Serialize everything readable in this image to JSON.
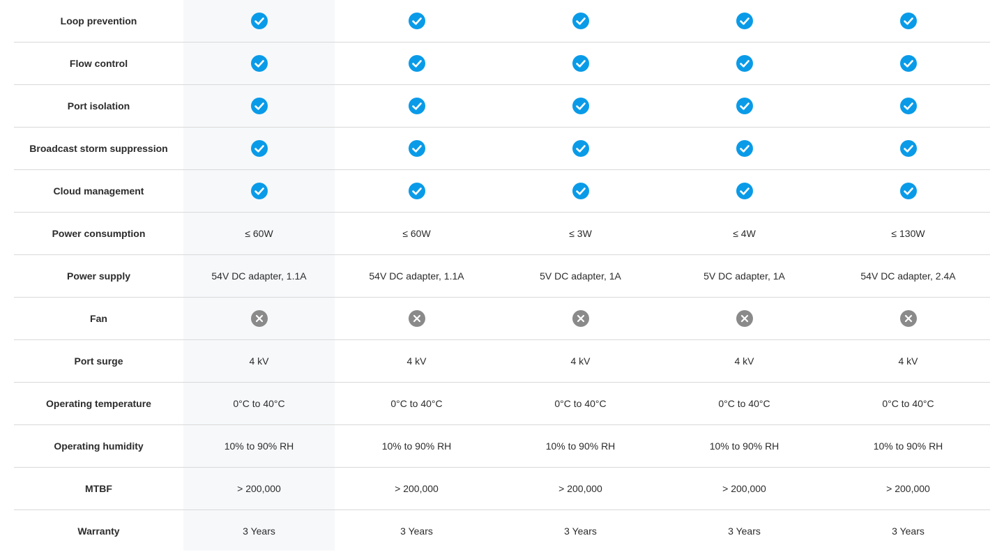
{
  "colors": {
    "check": "#0a9be8",
    "cross": "#8a8a8a",
    "highlight_column": "#f6f8fa",
    "divider": "#d9d9d9"
  },
  "rows": [
    {
      "label": "Loop prevention",
      "type": "icon",
      "cells": [
        "check-icon",
        "check-icon",
        "check-icon",
        "check-icon",
        "check-icon"
      ]
    },
    {
      "label": "Flow control",
      "type": "icon",
      "cells": [
        "check-icon",
        "check-icon",
        "check-icon",
        "check-icon",
        "check-icon"
      ]
    },
    {
      "label": "Port isolation",
      "type": "icon",
      "cells": [
        "check-icon",
        "check-icon",
        "check-icon",
        "check-icon",
        "check-icon"
      ]
    },
    {
      "label": "Broadcast storm suppression",
      "type": "icon",
      "cells": [
        "check-icon",
        "check-icon",
        "check-icon",
        "check-icon",
        "check-icon"
      ]
    },
    {
      "label": "Cloud management",
      "type": "icon",
      "cells": [
        "check-icon",
        "check-icon",
        "check-icon",
        "check-icon",
        "check-icon"
      ]
    },
    {
      "label": "Power consumption",
      "type": "text",
      "cells": [
        "≤ 60W",
        "≤ 60W",
        "≤ 3W",
        "≤ 4W",
        "≤ 130W"
      ]
    },
    {
      "label": "Power supply",
      "type": "text",
      "cells": [
        "54V DC adapter, 1.1A",
        "54V DC adapter, 1.1A",
        "5V DC adapter, 1A",
        "5V DC adapter, 1A",
        "54V DC adapter, 2.4A"
      ]
    },
    {
      "label": "Fan",
      "type": "icon",
      "cells": [
        "cross-icon",
        "cross-icon",
        "cross-icon",
        "cross-icon",
        "cross-icon"
      ]
    },
    {
      "label": "Port surge",
      "type": "text",
      "cells": [
        "4 kV",
        "4 kV",
        "4 kV",
        "4 kV",
        "4 kV"
      ]
    },
    {
      "label": "Operating temperature",
      "type": "text",
      "cells": [
        "0°C to 40°C",
        "0°C to 40°C",
        "0°C to 40°C",
        "0°C to 40°C",
        "0°C to 40°C"
      ]
    },
    {
      "label": "Operating humidity",
      "type": "text",
      "cells": [
        "10% to 90% RH",
        "10% to 90% RH",
        "10% to 90% RH",
        "10% to 90% RH",
        "10% to 90% RH"
      ]
    },
    {
      "label": "MTBF",
      "type": "text",
      "cells": [
        "> 200,000",
        "> 200,000",
        "> 200,000",
        "> 200,000",
        "> 200,000"
      ]
    },
    {
      "label": "Warranty",
      "type": "text",
      "cells": [
        "3 Years",
        "3 Years",
        "3 Years",
        "3 Years",
        "3 Years"
      ]
    }
  ]
}
